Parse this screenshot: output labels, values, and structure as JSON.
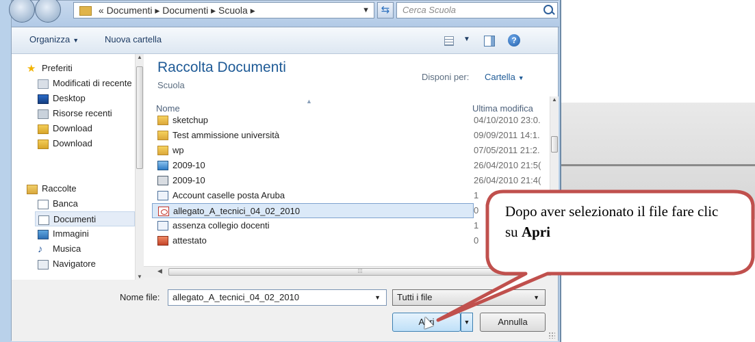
{
  "address_bar": {
    "path": "« Documenti ▸ Documenti ▸ Scuola ▸",
    "search_placeholder": "Cerca Scuola"
  },
  "toolbar": {
    "organize_label": "Organizza",
    "new_folder_label": "Nuova cartella"
  },
  "nav": {
    "favorites_header": "Preferiti",
    "items": [
      {
        "label": "Modificati di recente",
        "icon": "recent-places-icon"
      },
      {
        "label": "Desktop",
        "icon": "desktop-icon"
      },
      {
        "label": "Risorse recenti",
        "icon": "recent-places-icon"
      },
      {
        "label": "Download",
        "icon": "download-folder-icon"
      },
      {
        "label": "Download",
        "icon": "download-folder-icon"
      }
    ],
    "libraries_header": "Raccolte",
    "library_items": [
      {
        "label": "Banca",
        "icon": "document-library-icon"
      },
      {
        "label": "Documenti",
        "icon": "document-library-icon",
        "selected": true
      },
      {
        "label": "Immagini",
        "icon": "picture-library-icon"
      },
      {
        "label": "Musica",
        "icon": "music-library-icon"
      },
      {
        "label": "Navigatore",
        "icon": "document-library-icon"
      }
    ]
  },
  "main": {
    "library_title": "Raccolta Documenti",
    "library_subtitle": "Scuola",
    "arrange_label": "Disponi per:",
    "arrange_value": "Cartella",
    "columns": {
      "name": "Nome",
      "date": "Ultima modifica"
    },
    "files": [
      {
        "name": "sketchup",
        "date": "04/10/2010 23:0.",
        "icon": "folder-icon"
      },
      {
        "name": "Test ammissione università",
        "date": "09/09/2011 14:1.",
        "icon": "folder-icon"
      },
      {
        "name": "wp",
        "date": "07/05/2011 21:2.",
        "icon": "folder-icon"
      },
      {
        "name": "2009-10",
        "date": "26/04/2010 21:5(",
        "icon": "image-file-icon"
      },
      {
        "name": "2009-10",
        "date": "26/04/2010 21:4(",
        "icon": "media-file-icon"
      },
      {
        "name": "Account caselle posta Aruba",
        "date": "1",
        "icon": "publisher-file-icon"
      },
      {
        "name": "allegato_A_tecnici_04_02_2010",
        "date": "0",
        "icon": "pdf-file-icon",
        "selected": true
      },
      {
        "name": "assenza collegio docenti",
        "date": "1",
        "icon": "publisher-file-icon"
      },
      {
        "name": "attestato",
        "date": "0",
        "icon": "presentation-file-icon"
      }
    ]
  },
  "bottom": {
    "filename_label": "Nome file:",
    "filename_value": "allegato_A_tecnici_04_02_2010",
    "filter_value": "Tutti i file",
    "open_label": "Apri",
    "cancel_label": "Annulla"
  },
  "callout": {
    "text_before": "Dopo aver selezionato il file fare clic su ",
    "text_bold": "Apri",
    "fill_color": "#ffffff",
    "border_color": "#c0504d"
  }
}
